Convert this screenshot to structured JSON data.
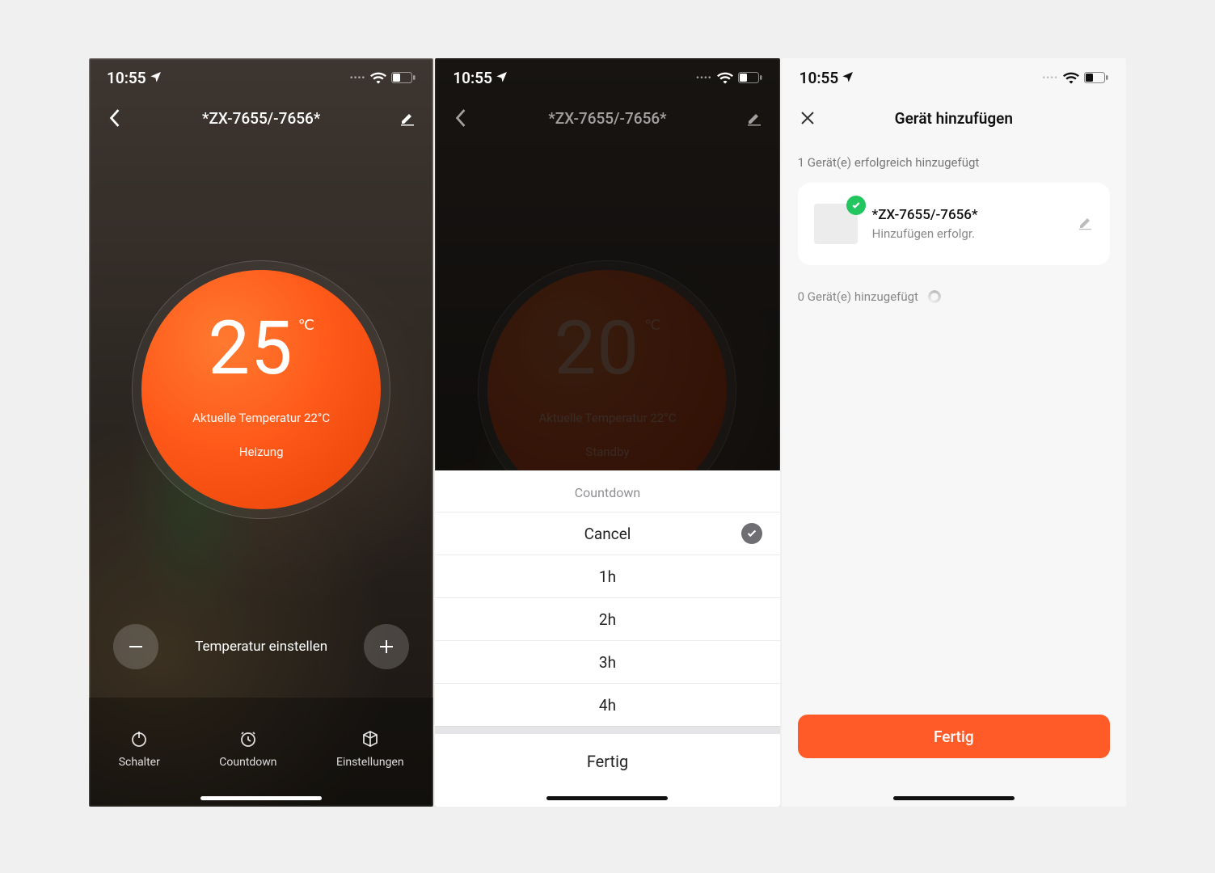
{
  "statusbar": {
    "time": "10:55"
  },
  "screen1": {
    "title": "*ZX-7655/-7656*",
    "dial": {
      "temp": "25",
      "unit": "℃",
      "current_line": "Aktuelle Temperatur 22°C",
      "mode": "Heizung"
    },
    "set_label": "Temperatur einstellen",
    "bbar": {
      "switch": "Schalter",
      "countdown": "Countdown",
      "settings": "Einstellungen"
    }
  },
  "screen2": {
    "title": "*ZX-7655/-7656*",
    "dial": {
      "temp": "20",
      "unit": "℃",
      "current_line": "Aktuelle Temperatur 22°C",
      "mode": "Standby"
    },
    "sheet": {
      "title": "Countdown",
      "options": [
        "Cancel",
        "1h",
        "2h",
        "3h",
        "4h"
      ],
      "done": "Fertig"
    }
  },
  "screen3": {
    "title": "Gerät hinzufügen",
    "success_line": "1 Gerät(e) erfolgreich hinzugefügt",
    "device": {
      "name": "*ZX-7655/-7656*",
      "status": "Hinzufügen erfolgr."
    },
    "pending_line": "0 Gerät(e) hinzugefügt",
    "done": "Fertig"
  },
  "colors": {
    "accent": "#ff5b29",
    "success": "#22c55e"
  }
}
